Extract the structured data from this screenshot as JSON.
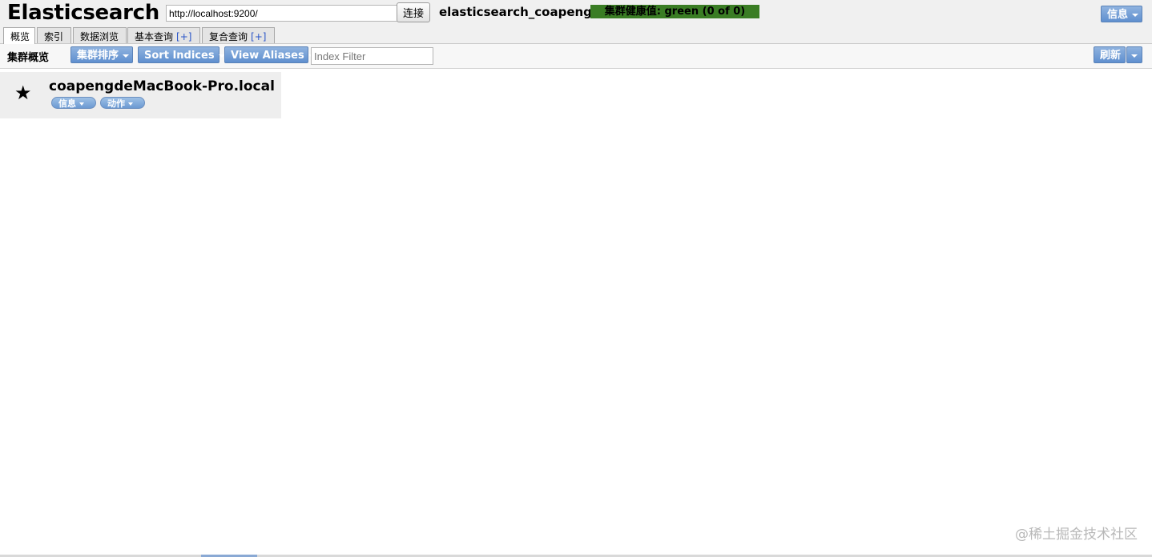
{
  "app": {
    "title": "Elasticsearch",
    "url": "http://localhost:9200/",
    "connect_label": "连接",
    "cluster_name": "elasticsearch_coapeng",
    "health": "集群健康值: green (0 of 0)",
    "health_color": "#3a7d24",
    "info_label": "信息"
  },
  "tabs": [
    {
      "label": "概览",
      "active": true
    },
    {
      "label": "索引"
    },
    {
      "label": "数据浏览"
    },
    {
      "label": "基本查询",
      "plus": "[+]"
    },
    {
      "label": "复合查询",
      "plus": "[+]"
    }
  ],
  "toolbar": {
    "title": "集群概览",
    "sort_cluster": "集群排序",
    "sort_indices": "Sort Indices",
    "view_aliases": "View Aliases",
    "filter_placeholder": "Index Filter",
    "refresh": "刷新"
  },
  "node": {
    "name": "coapengdeMacBook-Pro.local",
    "info": "信息",
    "actions": "动作",
    "icon": "star-icon"
  },
  "watermark": "@稀土掘金技术社区",
  "accent": "#6b99d2"
}
